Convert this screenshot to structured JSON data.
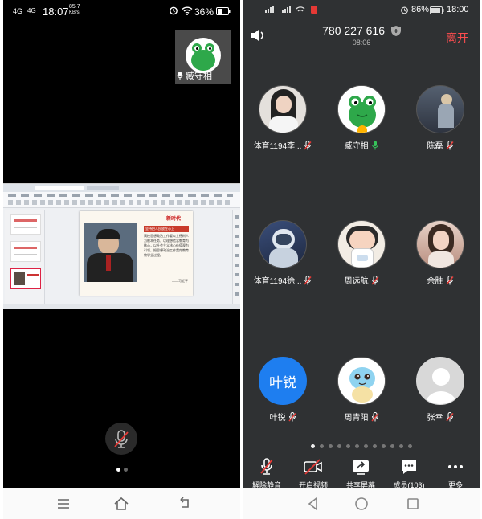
{
  "left_phone": {
    "status": {
      "signal": "4G",
      "signal_sub": "4G",
      "time": "18:07",
      "net_speed_top": "85.7",
      "net_speed_unit": "KB/s",
      "battery": "36%"
    },
    "pip": {
      "name": "臧守相"
    },
    "share": {
      "slide_tag": "新时代",
      "slide_heading": "坚持把人民放在心上",
      "slide_body": "高校思想政治工作要以立德树人为根本任务，以理想信念教育为核心，以社会主义核心价值观为引领，把思想政治工作贯穿教育教学全过程。",
      "slide_quote": "——习近平"
    }
  },
  "right_phone": {
    "status": {
      "battery": "86%",
      "time": "18:00"
    },
    "meeting_number": "780 227 616",
    "timer": "08:06",
    "leave_label": "离开",
    "participants": [
      {
        "name": "体育1194李...",
        "muted": true
      },
      {
        "name": "臧守相",
        "muted": false
      },
      {
        "name": "陈磊",
        "muted": true
      },
      {
        "name": "体育1194徐...",
        "muted": true
      },
      {
        "name": "周远航",
        "muted": true
      },
      {
        "name": "余胜",
        "muted": true
      },
      {
        "name": "叶锐",
        "muted": true,
        "avatar_text": "叶锐"
      },
      {
        "name": "周青阳",
        "muted": true
      },
      {
        "name": "张幸",
        "muted": true
      }
    ],
    "toolbar": {
      "unmute": "解除静音",
      "video": "开启视频",
      "share": "共享屏幕",
      "members": "成员(103)",
      "more": "更多"
    }
  },
  "colors": {
    "accent_red": "#ff4d4f",
    "avatar_blue": "#1e7ef0",
    "dark_bg": "#2f3133"
  }
}
